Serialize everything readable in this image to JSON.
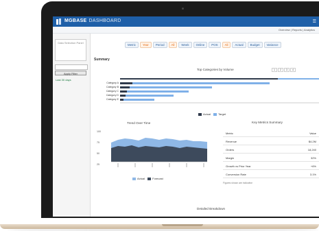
{
  "app": {
    "brand": "MGBASE",
    "brand_sub": "DASHBOARD"
  },
  "subbar": {
    "links": "Overview  |  Reports  |  Analytics"
  },
  "sidebar": {
    "card_text": "Data Selection Panel",
    "button_label": "Apply Filter",
    "link_text": "Last 30 days"
  },
  "filters": [
    {
      "label": "Metric",
      "accent": false
    },
    {
      "label": "Year",
      "accent": true
    },
    {
      "label": "Period",
      "accent": false
    },
    {
      "label": "All",
      "accent": true
    },
    {
      "label": "Week",
      "accent": false
    },
    {
      "label": "Online",
      "accent": false
    },
    {
      "label": "POS",
      "accent": false
    },
    {
      "label": "All",
      "accent": true
    },
    {
      "label": "Actual",
      "accent": false
    },
    {
      "label": "Budget",
      "accent": false
    },
    {
      "label": "Variance",
      "accent": false
    }
  ],
  "section": {
    "title": "Summary"
  },
  "bar_chart": {
    "title": "Top Categories by Volume",
    "labels": [
      "Category A",
      "Category B",
      "Category C",
      "Category D",
      "Category E"
    ],
    "legend": [
      "Actual",
      "Target"
    ],
    "pager": [
      "1",
      "2",
      "3",
      "4"
    ]
  },
  "area_chart": {
    "title": "Trend Over Time",
    "y_ticks": [
      "100",
      "75",
      "50",
      "25"
    ],
    "legend": [
      "Actual",
      "Forecast"
    ]
  },
  "table": {
    "title": "Key Metrics Summary",
    "rows": [
      {
        "k": "Metric",
        "v": "Value"
      },
      {
        "k": "Revenue",
        "v": "$4.2M"
      },
      {
        "k": "Orders",
        "v": "18,240"
      },
      {
        "k": "Margin",
        "v": "32%"
      },
      {
        "k": "Growth vs Prior Year",
        "v": "+6%"
      },
      {
        "k": "Conversion Rate",
        "v": "3.1%"
      }
    ],
    "footnote": "Figures shown are indicative"
  },
  "bottom": {
    "title": "Detailed Breakdown"
  },
  "colors": {
    "header": "#1e5fa8",
    "bar_dark": "#2f3a4b",
    "bar_light": "#7fb0e8",
    "area_light": "#8fb8e6",
    "area_dark": "#3d4a5c",
    "accent_orange": "#e8701a"
  }
}
